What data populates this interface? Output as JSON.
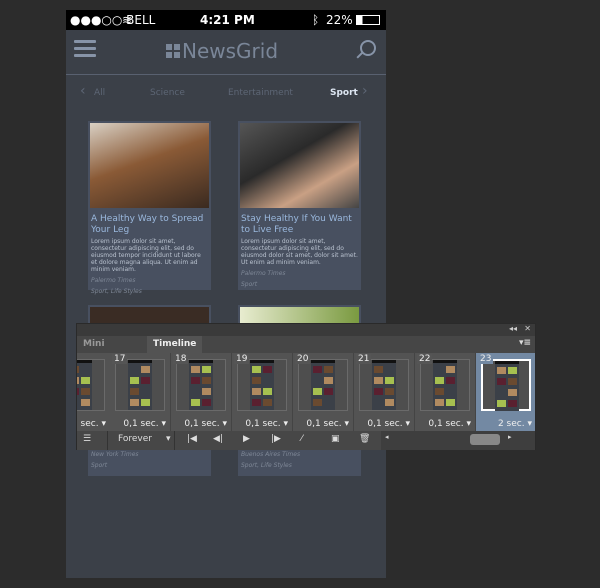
{
  "status": {
    "carrier": "●●●○○ BELL",
    "time": "4:21 PM",
    "battery": "22%"
  },
  "app": {
    "title": "NewsGrid"
  },
  "categories": [
    {
      "label": "All"
    },
    {
      "label": "Science"
    },
    {
      "label": "Entertainment"
    },
    {
      "label": "Sport"
    }
  ],
  "cards": [
    {
      "title": "A Healthy Way to Spread Your Leg",
      "body": "Lorem ipsum dolor sit amet, consectetur adipiscing elit, sed do eiusmod tempor incididunt ut labore et dolore magna aliqua. Ut enim ad minim veniam.",
      "source": "Palermo Times",
      "tags": "Sport, Life Styles"
    },
    {
      "title": "Stay Healthy If You Want to Live Free",
      "body": "Lorem ipsum dolor sit amet, consectetur adipiscing elit, sed do eiusmod dolor sit amet, dolor sit amet. Ut enim ad minim veniam.",
      "source": "Palermo Times",
      "tags": "Sport"
    },
    {
      "source": "New York Times",
      "tags": "Sport"
    },
    {
      "source": "Buenos Aires Times",
      "tags": "Sport, Life Styles"
    }
  ],
  "panel": {
    "tabs": [
      "Mini Bridge",
      "Timeline"
    ],
    "active_tab": "Timeline",
    "frames": [
      {
        "num": "",
        "delay": "sec."
      },
      {
        "num": "17",
        "delay": "0,1 sec."
      },
      {
        "num": "18",
        "delay": "0,1 sec."
      },
      {
        "num": "19",
        "delay": "0,1 sec."
      },
      {
        "num": "20",
        "delay": "0,1 sec."
      },
      {
        "num": "21",
        "delay": "0,1 sec."
      },
      {
        "num": "22",
        "delay": "0,1 sec."
      },
      {
        "num": "23",
        "delay": "2 sec."
      }
    ],
    "selected_frame": "23",
    "loop": "Forever"
  }
}
